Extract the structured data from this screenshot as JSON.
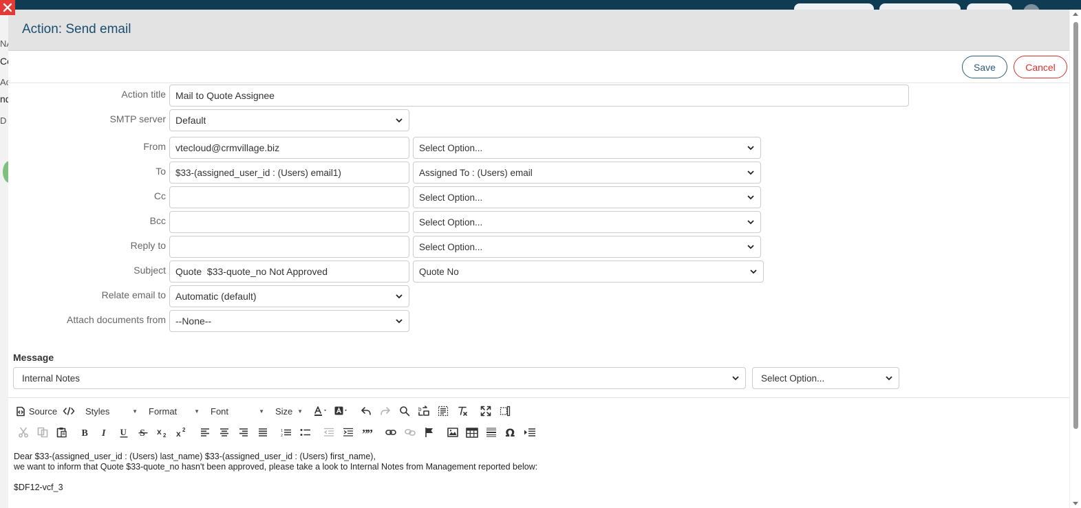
{
  "background": {
    "left_texts": [
      "NA",
      "Co",
      "Ac",
      "nd",
      "D"
    ]
  },
  "modal": {
    "title": "Action: Send email",
    "save_label": "Save",
    "cancel_label": "Cancel"
  },
  "form": {
    "action_title": {
      "label": "Action title",
      "value": "Mail to Quote Assignee"
    },
    "smtp_server": {
      "label": "SMTP server",
      "value": "Default"
    },
    "from": {
      "label": "From",
      "value": "vtecloud@crmvillage.biz",
      "option": "Select Option..."
    },
    "to": {
      "label": "To",
      "value": "$33-(assigned_user_id : (Users) email1)",
      "option": "Assigned To : (Users) email"
    },
    "cc": {
      "label": "Cc",
      "value": "",
      "option": "Select Option..."
    },
    "bcc": {
      "label": "Bcc",
      "value": "",
      "option": "Select Option..."
    },
    "reply_to": {
      "label": "Reply to",
      "value": "",
      "option": "Select Option..."
    },
    "subject": {
      "label": "Subject",
      "value": "Quote  $33-quote_no Not Approved",
      "option": "Quote No"
    },
    "relate_email_to": {
      "label": "Relate email to",
      "value": "Automatic (default)"
    },
    "attach_documents_from": {
      "label": "Attach documents from",
      "value": "--None--"
    }
  },
  "message": {
    "label": "Message",
    "field_select": "Internal Notes",
    "option_select": "Select Option..."
  },
  "toolbar": {
    "source_label": "Source",
    "styles_label": "Styles",
    "format_label": "Format",
    "font_label": "Font",
    "size_label": "Size"
  },
  "editor": {
    "line1": "Dear $33-(assigned_user_id : (Users) last_name) $33-(assigned_user_id : (Users) first_name),",
    "line2": "we want to inform that Quote $33-quote_no hasn't been approved, please take a look to Internal Notes from Management reported below:",
    "line3": "$DF12-vcf_3"
  },
  "colors": {
    "accent": "#2d5a7a",
    "danger": "#d9302c",
    "header_bg": "#e3e3e3",
    "topbar": "#0f3b53"
  }
}
